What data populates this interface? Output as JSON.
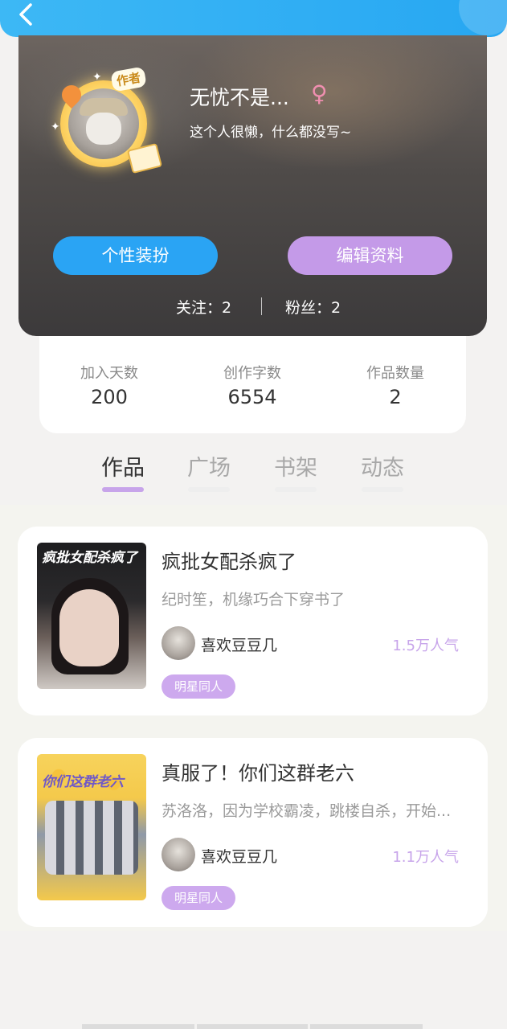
{
  "header": {
    "back_icon": "chevron-left-icon"
  },
  "profile": {
    "avatar_badge": "作者",
    "nickname": "无忧不是...",
    "gender_icon": "♀",
    "bio": "这个人很懒，什么都没写~",
    "dress_button": "个性装扮",
    "edit_button": "编辑资料",
    "following": "关注：2",
    "followers": "粉丝：2"
  },
  "stats": [
    {
      "label": "加入天数",
      "value": "200"
    },
    {
      "label": "创作字数",
      "value": "6554"
    },
    {
      "label": "作品数量",
      "value": "2"
    }
  ],
  "tabs": [
    "作品",
    "广场",
    "书架",
    "动态"
  ],
  "active_tab": "作品",
  "works": [
    {
      "title": "疯批女配杀疯了",
      "cover_title": "疯批女配杀疯了",
      "desc": "纪时笙，机缘巧合下穿书了",
      "author": "喜欢豆豆几",
      "popularity": "1.5万人气",
      "tag": "明星同人"
    },
    {
      "title": "真服了！你们这群老六",
      "cover_title": "你们这群老六",
      "desc": "苏洛洛，因为学校霸凌，跳楼自杀，开始...",
      "author": "喜欢豆豆几",
      "popularity": "1.1万人气",
      "tag": "明星同人"
    }
  ],
  "colors": {
    "topbar": "#2aa9f3",
    "dress_button": "#2aa4f4",
    "edit_button": "#c49ae8",
    "accent_purple": "#c7a4ea"
  }
}
